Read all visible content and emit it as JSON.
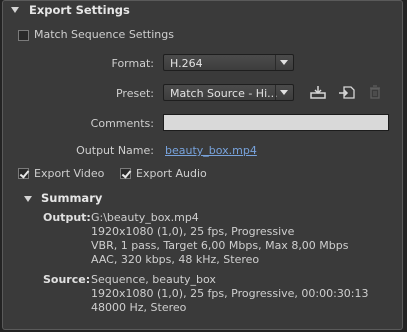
{
  "section": {
    "title": "Export Settings"
  },
  "match_sequence": {
    "label": "Match Sequence Settings",
    "checked": false
  },
  "format": {
    "label": "Format:",
    "value": "H.264"
  },
  "preset": {
    "label": "Preset:",
    "value": "Match Source - Hi..."
  },
  "comments": {
    "label": "Comments:",
    "value": ""
  },
  "output_name": {
    "label": "Output Name:",
    "value": "beauty_box.mp4"
  },
  "export_video": {
    "label": "Export Video",
    "checked": true
  },
  "export_audio": {
    "label": "Export Audio",
    "checked": true
  },
  "summary": {
    "title": "Summary",
    "output": {
      "label": "Output:",
      "lines": [
        "G:\\beauty_box.mp4",
        "1920x1080 (1,0), 25 fps, Progressive",
        "VBR, 1 pass, Target 6,00 Mbps, Max 8,00 Mbps",
        "AAC, 320 kbps, 48 kHz, Stereo"
      ]
    },
    "source": {
      "label": "Source:",
      "lines": [
        "Sequence, beauty_box",
        "1920x1080 (1,0), 25 fps, Progressive, 00:00:30:13",
        "48000 Hz, Stereo"
      ]
    }
  },
  "icons": [
    "save-preset-icon",
    "import-preset-icon",
    "delete-preset-icon"
  ]
}
